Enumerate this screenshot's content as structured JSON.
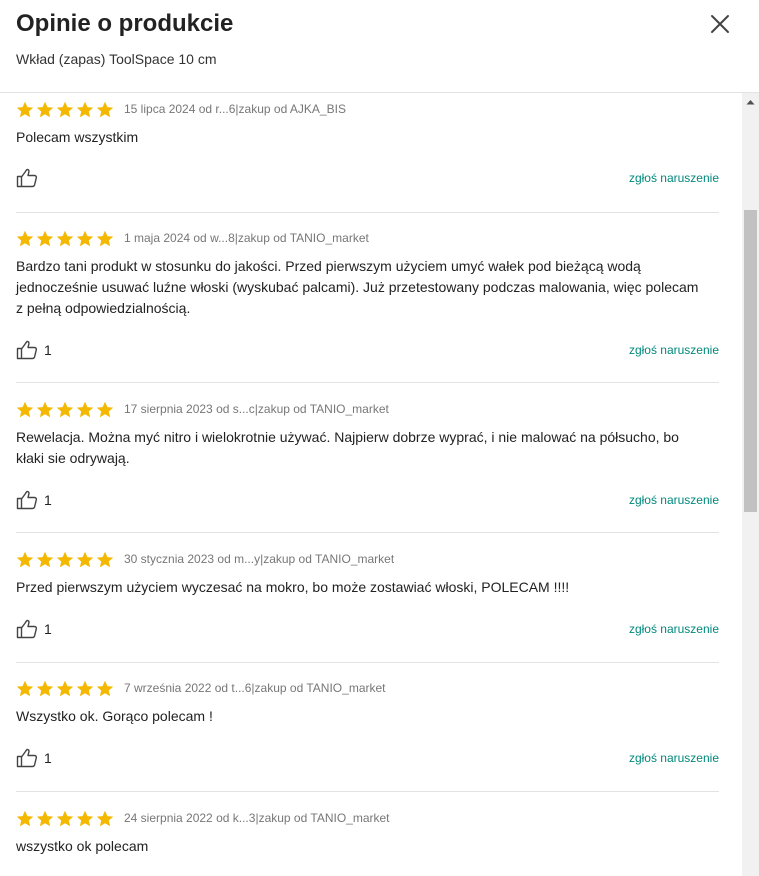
{
  "header": {
    "title": "Opinie o produkcie",
    "subtitle": "Wkład (zapas) ToolSpace 10 cm",
    "close_icon": "close-icon"
  },
  "colors": {
    "star": "#f5b800",
    "link": "#00897b",
    "divider": "#e3e3e3"
  },
  "reviews": [
    {
      "rating": 5,
      "date_author": "15 lipca 2024 od r...6",
      "seller": "zakup od AJKA_BIS",
      "text": "Polecam wszystkim",
      "likes": "",
      "report": "zgłoś naruszenie"
    },
    {
      "rating": 5,
      "date_author": "1 maja 2024 od w...8",
      "seller": "zakup od TANIO_market",
      "text": "Bardzo tani produkt w stosunku do jakości. Przed pierwszym użyciem umyć wałek pod bieżącą wodą jednocześnie usuwać luźne włoski (wyskubać palcami). Już przetestowany podczas malowania, więc polecam z pełną odpowiedzialnością.",
      "likes": "1",
      "report": "zgłoś naruszenie"
    },
    {
      "rating": 5,
      "date_author": "17 sierpnia 2023 od s...c",
      "seller": "zakup od TANIO_market",
      "text": "Rewelacja. Można myć nitro i wielokrotnie używać. Najpierw dobrze wyprać, i nie malować na półsucho, bo kłaki sie odrywają.",
      "likes": "1",
      "report": "zgłoś naruszenie"
    },
    {
      "rating": 5,
      "date_author": "30 stycznia 2023 od m...y",
      "seller": "zakup od TANIO_market",
      "text": "Przed pierwszym użyciem wyczesać na mokro, bo może zostawiać włoski, POLECAM !!!!",
      "likes": "1",
      "report": "zgłoś naruszenie"
    },
    {
      "rating": 5,
      "date_author": "7 września 2022 od t...6",
      "seller": "zakup od TANIO_market",
      "text": "Wszystko ok. Gorąco polecam !",
      "likes": "1",
      "report": "zgłoś naruszenie"
    },
    {
      "rating": 5,
      "date_author": "24 sierpnia 2022 od k...3",
      "seller": "zakup od TANIO_market",
      "text": "wszystko ok polecam",
      "likes": "",
      "report": ""
    }
  ]
}
